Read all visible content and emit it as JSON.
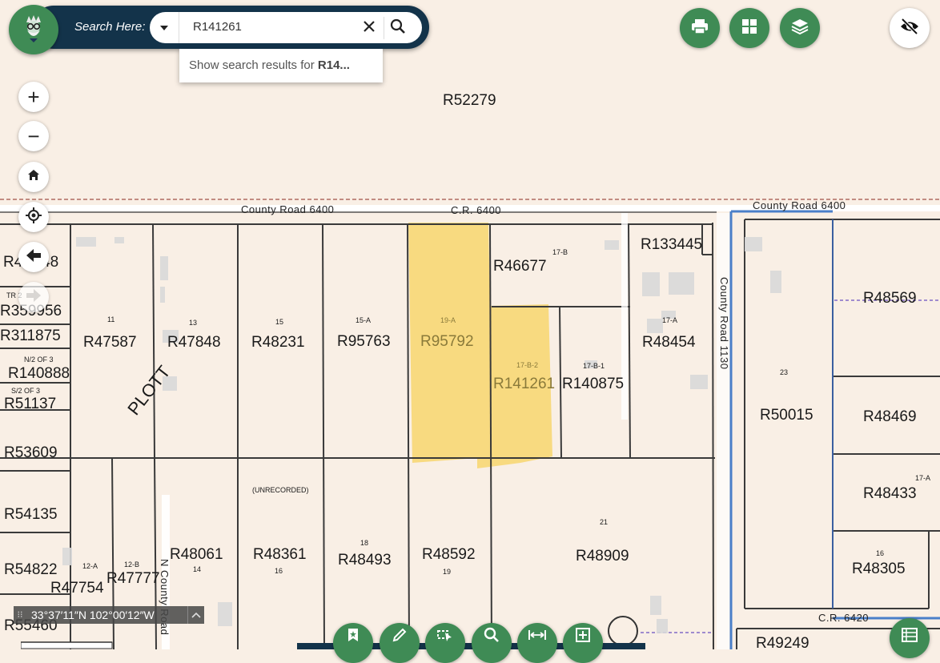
{
  "search": {
    "label": "Search Here:",
    "value": "R141261",
    "suggestion_prefix": "Show search results for ",
    "suggestion_bold": "R14..."
  },
  "toolbar": {
    "buttons": [
      {
        "name": "print-button",
        "icon": "printer-icon"
      },
      {
        "name": "basemap-gallery-button",
        "icon": "grid-icon"
      },
      {
        "name": "layers-button",
        "icon": "layers-icon"
      }
    ],
    "visibility_icon": "eye-off-icon"
  },
  "map_controls": {
    "zoom_in": "+",
    "zoom_out": "−"
  },
  "coordinates": "33°37′11″N 102°00′12″W",
  "roads": {
    "north": "County Road 6400",
    "north_center": "C.R. 6400",
    "north_right": "County Road 6400",
    "east": "County Road 1130",
    "south_right": "C.R. 6420",
    "west": "N County Road",
    "plott": "PLOTT"
  },
  "parcels": {
    "R52279": "R52279",
    "R46677": "R46677",
    "R133445": "R133445",
    "R47587": "R47587",
    "R47848": "R47848",
    "R48231": "R48231",
    "R95763": "R95763",
    "R95792": "R95792",
    "R141261": "R141261",
    "R140875": "R140875",
    "R48454": "R48454",
    "R50015": "R50015",
    "R48569": "R48569",
    "R48469": "R48469",
    "R48433": "R48433",
    "R48305": "R48305",
    "R49249": "R49249",
    "R48061": "R48061",
    "R48361": "R48361",
    "R48493": "R48493",
    "R48592": "R48592",
    "R48909": "R48909",
    "R47754": "R47754",
    "R47777": "R47777",
    "R4xx48": "R4",
    "R4xx48b": "48",
    "R359956": "R359956",
    "R311875": "R311875",
    "R140888": "R140888",
    "R51137": "R51137",
    "R53609": "R53609",
    "R54135": "R54135",
    "R54822": "R54822",
    "R55460": "R55460"
  },
  "lot_numbers": {
    "n11": "11",
    "n13": "13",
    "n15": "15",
    "n15A": "15-A",
    "n19A": "19-A",
    "n17B": "17-B",
    "n17B2": "17-B-2",
    "n17B1": "17-B-1",
    "n17A": "17-A",
    "n23": "23",
    "n21": "21",
    "n18": "18",
    "n19": "19",
    "n16": "16",
    "n14": "14",
    "n12A": "12-A",
    "n12B": "12-B",
    "n16r": "16",
    "n17Ar": "17-A",
    "unrecorded": "(UNRECORDED)",
    "tr2": "TR 2",
    "n2of3": "N/2 OF 3",
    "s2of3": "S/2 OF 3"
  },
  "colors": {
    "parcel_fill": "#f9efe5",
    "highlight": "#f7d774",
    "accent_green": "#3f8b55",
    "search_bar_navy": "#13334a",
    "boundary_blue": "#4a7fc9"
  }
}
